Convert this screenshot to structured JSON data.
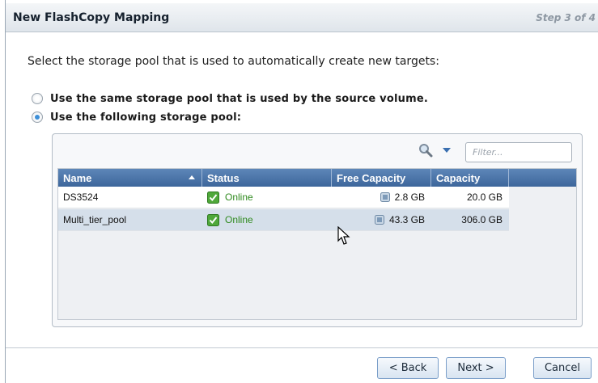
{
  "dialog": {
    "title": "New FlashCopy Mapping",
    "step": "Step 3 of 4",
    "instruction": "Select the storage pool that is used to automatically create new targets:"
  },
  "options": [
    {
      "label": "Use the same storage pool that is used by the source volume.",
      "selected": false
    },
    {
      "label": "Use the following storage pool:",
      "selected": true
    }
  ],
  "table": {
    "filter_placeholder": "Filter...",
    "columns": [
      "Name",
      "Status",
      "Free Capacity",
      "Capacity"
    ],
    "sort_column": "Name",
    "sort_direction": "ascending",
    "rows": [
      {
        "name": "DS3524",
        "status": "Online",
        "free_capacity": "2.8 GB",
        "capacity": "20.0 GB",
        "selected": false
      },
      {
        "name": "Multi_tier_pool",
        "status": "Online",
        "free_capacity": "43.3 GB",
        "capacity": "306.0 GB",
        "selected": true
      }
    ]
  },
  "buttons": {
    "back": "< Back",
    "next": "Next >",
    "cancel": "Cancel"
  },
  "colors": {
    "header_blue": "#4a73a8",
    "online_green": "#2f8a1e",
    "selected_row": "#d5dfea"
  }
}
